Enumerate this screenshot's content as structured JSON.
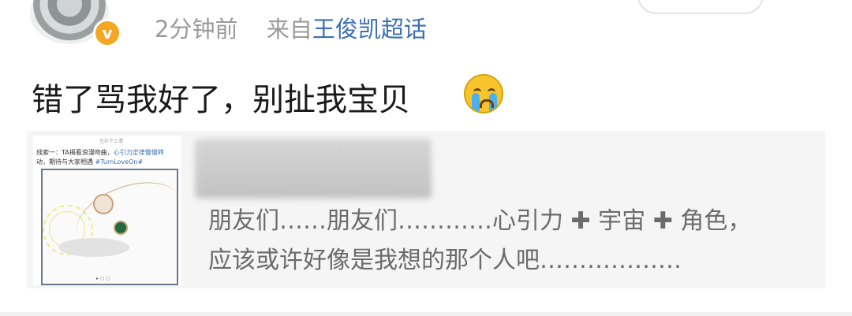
{
  "header": {
    "time": "2分钟前",
    "from_prefix": "来自",
    "source": "王俊凯超话",
    "verified_badge": "v"
  },
  "post": {
    "text": "错了骂我好了，别扯我宝贝",
    "emoji": "crying-face"
  },
  "card": {
    "thumb": {
      "top_caption": "左右下上滑",
      "line1_prefix": "线索一：TA揭看浪漫吻曲，",
      "line1_highlight": "心引力定律慢慢转",
      "line2_prefix": "动，期待与大家相遇 ",
      "line2_tag": "#TurnLoveOn#",
      "bottom_caption": "▸ ○ ○"
    },
    "description_line1": "朋友们……朋友们…………心引力 ✚ 宇宙 ✚ 角色，",
    "description_line2": "应该或许好像是我想的那个人吧………………"
  },
  "colors": {
    "link": "#3b6fb3",
    "meta": "#9a9a9a",
    "badge": "#f5a623"
  }
}
